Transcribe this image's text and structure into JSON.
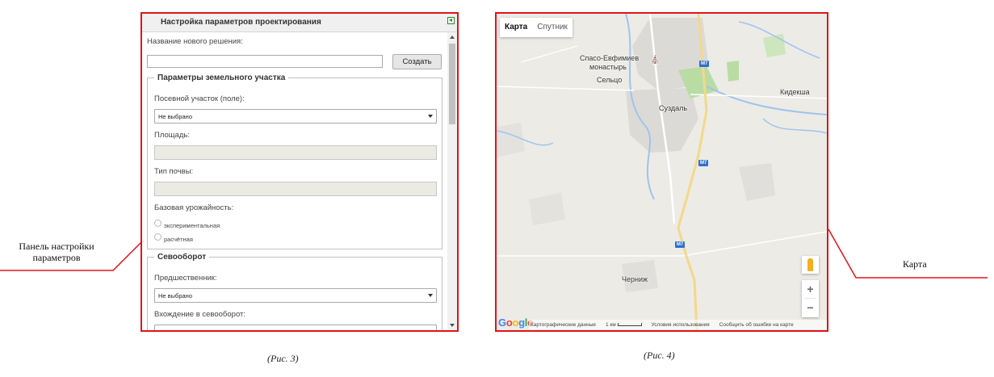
{
  "panel": {
    "title": "Настройка параметров проектирования",
    "new_solution_label": "Название нового решения:",
    "new_solution_value": "",
    "create_button": "Создать",
    "land_section": {
      "legend": "Параметры земельного участка",
      "field_label": "Посевной участок (поле):",
      "field_value": "Не выбрано",
      "area_label": "Площадь:",
      "soil_label": "Тип почвы:",
      "yield_label": "Базовая урожайность:",
      "yield_options": [
        "экспериментальная",
        "расчётная"
      ]
    },
    "rotation_section": {
      "legend": "Севооборот",
      "predecessor_label": "Предшественник:",
      "predecessor_value": "Не выбрано",
      "entry_label": "Вхождение в севооборот:"
    }
  },
  "map": {
    "tabs": [
      "Карта",
      "Спутник"
    ],
    "active_tab": "Карта",
    "labels": {
      "monastery_1": "Спасо-Евфимиев",
      "monastery_2": "монастырь",
      "seltso": "Сельцо",
      "suzdal": "Суздаль",
      "kideksha": "Кидекша",
      "chernizh": "Черниж"
    },
    "road_badge": "M7",
    "zoom_in": "+",
    "zoom_out": "−",
    "google": "Google",
    "footer": {
      "map_data": "Картографические данные",
      "scale": "1 км",
      "terms": "Условия использования",
      "report": "Сообщить об ошибке на карте"
    },
    "colors": {
      "background": "#ecebe6",
      "water": "#9fc3f0",
      "park": "#b9dca4",
      "urban": "#dcdad6",
      "highway": "#f4d88a"
    }
  },
  "callouts": {
    "left": "Панель настройки параметров",
    "right": "Карта",
    "accent_color": "#e0131b"
  },
  "captions": {
    "fig3": "(Рис. 3)",
    "fig4": "(Рис. 4)"
  }
}
